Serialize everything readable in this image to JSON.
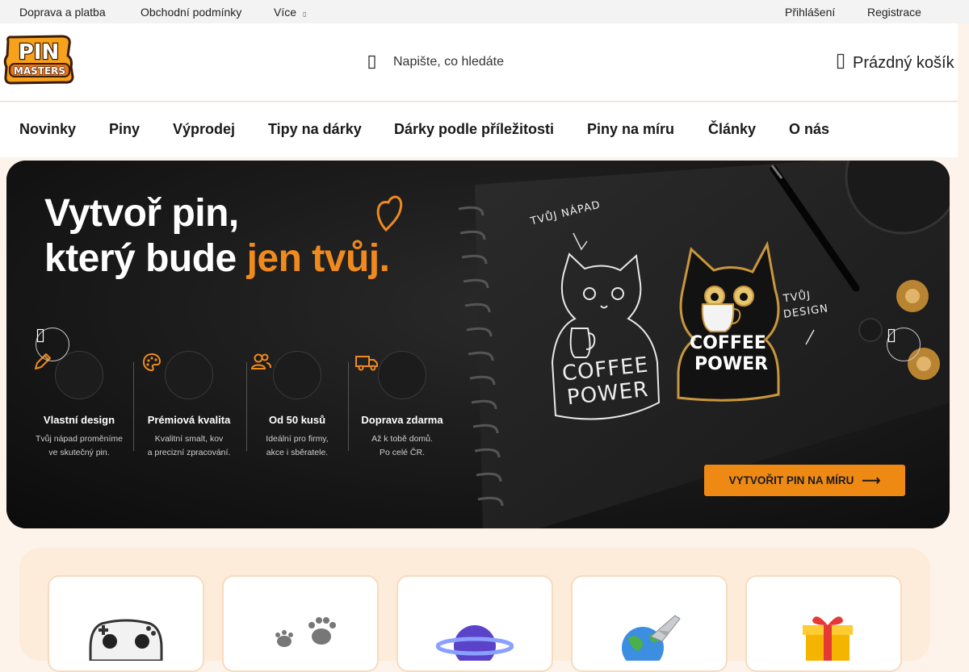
{
  "topbar": {
    "links": [
      "Doprava a platba",
      "Obchodní podmínky",
      "Více"
    ],
    "login": "Přihlášení",
    "register": "Registrace"
  },
  "header": {
    "logo_text": "PIN MASTERS",
    "search_placeholder": "Napište, co hledáte",
    "cart_label": "Prázdný košík"
  },
  "nav": {
    "items": [
      "Novinky",
      "Piny",
      "Výprodej",
      "Tipy na dárky",
      "Dárky podle příležitosti",
      "Piny na míru",
      "Články",
      "O nás"
    ]
  },
  "hero": {
    "title_line1": "Vytvoř pin,",
    "title_line2_plain": "který bude ",
    "title_line2_accent": "jen tvůj.",
    "features": [
      {
        "title": "Vlastní design",
        "desc1": "Tvůj nápad proměníme",
        "desc2": "ve skutečný pin."
      },
      {
        "title": "Prémiová kvalita",
        "desc1": "Kvalitní smalt, kov",
        "desc2": "a precizní zpracování."
      },
      {
        "title": "Od 50 kusů",
        "desc1": "Ideální pro firmy,",
        "desc2": "akce i sběratele."
      },
      {
        "title": "Doprava zdarma",
        "desc1": "Až k tobě domů.",
        "desc2": "Po celé ČR."
      }
    ],
    "note_idea": "TVŮJ NÁPAD",
    "note_design_1": "TVŮJ",
    "note_design_2": "DESIGN",
    "sketch_text_1": "COFFEE",
    "sketch_text_2": "POWER",
    "pin_text_1": "COFFEE",
    "pin_text_2": "POWER",
    "cta_label": "VYTVOŘIT PIN NA MÍRU",
    "cta_arrow": "⟶"
  },
  "colors": {
    "accent": "#f08a1d",
    "cta": "#ee8a14",
    "category_bg": "#fdecd9"
  },
  "icons": {
    "prev": "chevron-left-icon",
    "next": "chevron-right-icon",
    "search": "search-icon",
    "cart": "cart-icon"
  }
}
